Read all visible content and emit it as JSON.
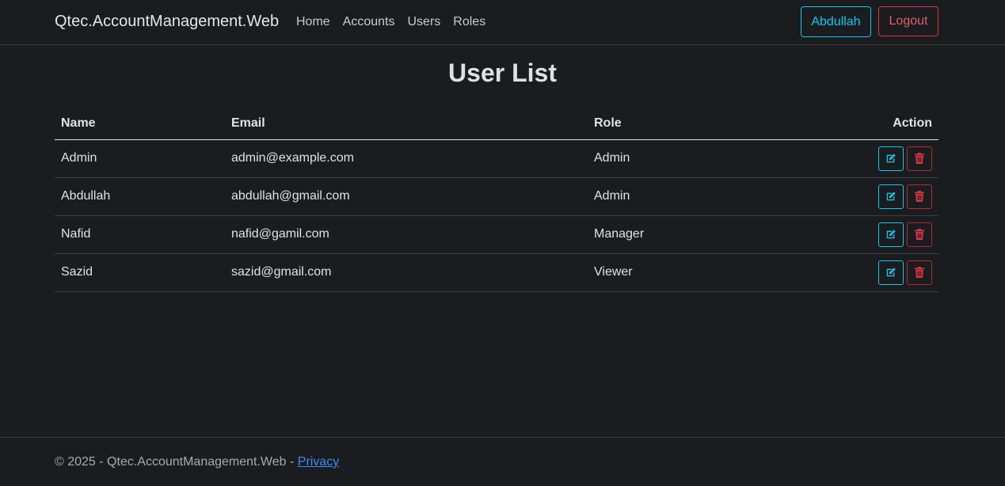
{
  "navbar": {
    "brand": "Qtec.AccountManagement.Web",
    "links": [
      {
        "label": "Home"
      },
      {
        "label": "Accounts"
      },
      {
        "label": "Users"
      },
      {
        "label": "Roles"
      }
    ],
    "user_label": "Abdullah",
    "logout_label": "Logout"
  },
  "page": {
    "title": "User List"
  },
  "table": {
    "headers": {
      "name": "Name",
      "email": "Email",
      "role": "Role",
      "action": "Action"
    },
    "rows": [
      {
        "name": "Admin",
        "email": "admin@example.com",
        "role": "Admin"
      },
      {
        "name": "Abdullah",
        "email": "abdullah@gmail.com",
        "role": "Admin"
      },
      {
        "name": "Nafid",
        "email": "nafid@gamil.com",
        "role": "Manager"
      },
      {
        "name": "Sazid",
        "email": "sazid@gmail.com",
        "role": "Viewer"
      }
    ]
  },
  "footer": {
    "text": "© 2025 - Qtec.AccountManagement.Web - ",
    "link": "Privacy"
  },
  "icons": {
    "edit": "edit-icon",
    "delete": "trash-icon"
  },
  "colors": {
    "background": "#1b1c1f",
    "info": "#0dcaf0",
    "danger": "#dc3545",
    "link": "#3d8bfd"
  }
}
